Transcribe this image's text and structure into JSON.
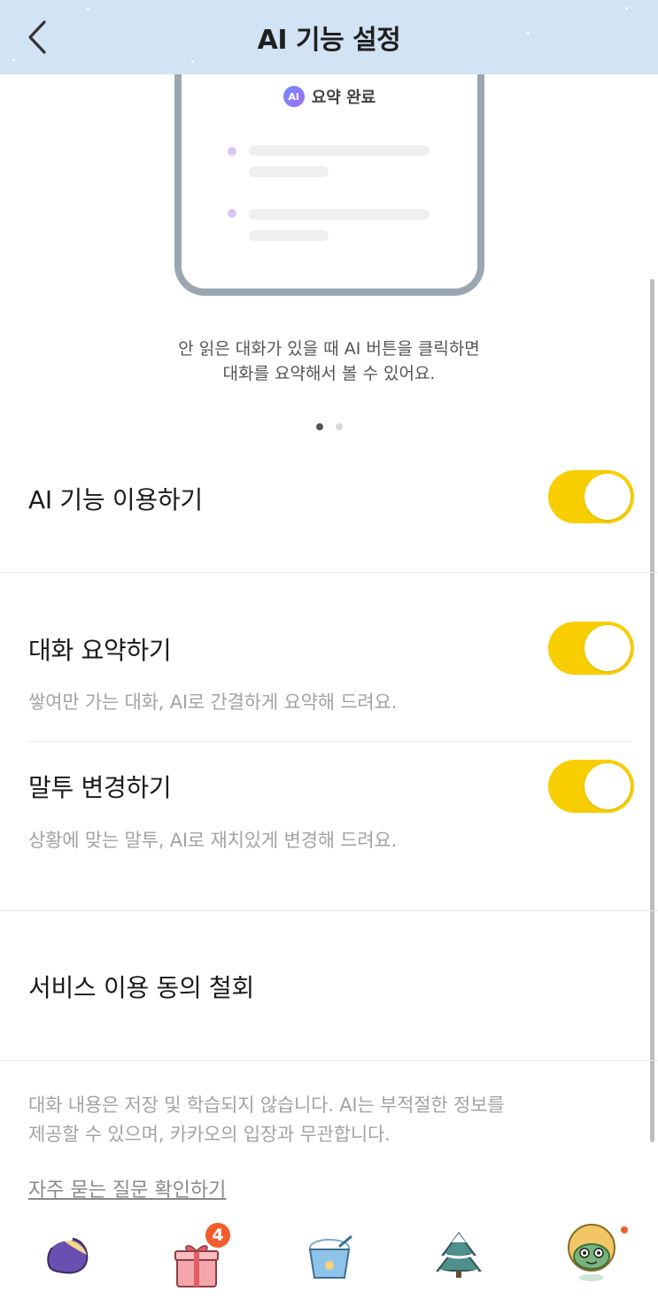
{
  "header": {
    "title": "AI 기능 설정",
    "back_icon": "chevron-left-icon",
    "background_color": "#d2e3f4"
  },
  "preview": {
    "badge_text": "AI",
    "mock_title": "요약 완료",
    "description_line1": "안 읽은 대화가 있을 때 AI 버튼을 클릭하면",
    "description_line2": "대화를 요약해서 볼 수 있어요.",
    "pager": {
      "count": 2,
      "active_index": 0
    }
  },
  "settings": {
    "ai_feature": {
      "label": "AI 기능 이용하기",
      "enabled": true
    },
    "summarize": {
      "label": "대화 요약하기",
      "description": "쌓여만 가는 대화, AI로 간결하게 요약해 드려요.",
      "enabled": true
    },
    "tone_change": {
      "label": "말투 변경하기",
      "description": "상황에 맞는 말투, AI로 재치있게 변경해 드려요.",
      "enabled": true
    },
    "toggle_on_color": "#f8ce00"
  },
  "withdraw": {
    "label": "서비스 이용 동의 철회"
  },
  "footer": {
    "note_line1": "대화 내용은 저장 및 학습되지 않습니다. AI는 부적절한 정보를",
    "note_line2": "제공할 수 있으며, 카카오의 입장과 무관합니다.",
    "faq_link": "자주 묻는 질문 확인하기"
  },
  "bottom_nav": {
    "items": [
      {
        "icon": "sweet-potato-icon"
      },
      {
        "icon": "gift-box-icon",
        "badge": "4"
      },
      {
        "icon": "ice-cream-cup-icon"
      },
      {
        "icon": "snowy-tree-icon"
      },
      {
        "icon": "character-avatar-icon",
        "has_dot": true
      }
    ],
    "badge_color": "#f25c2b"
  }
}
